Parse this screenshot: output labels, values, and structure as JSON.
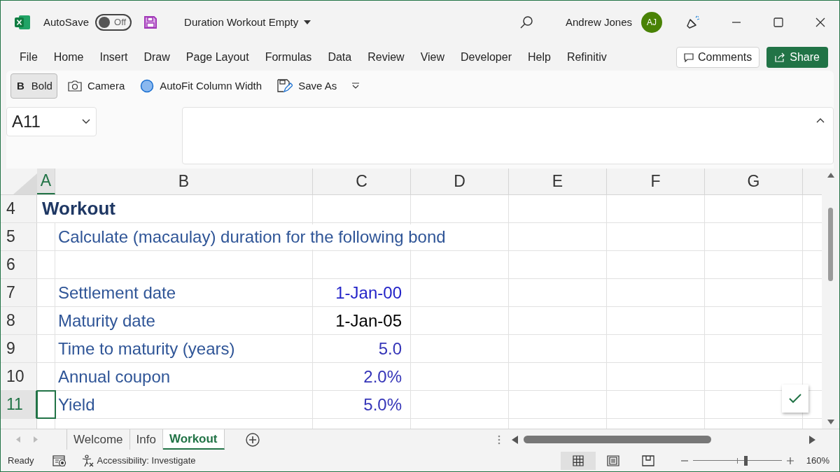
{
  "title_bar": {
    "autosave_label": "AutoSave",
    "autosave": {
      "on": false,
      "label": "Off"
    },
    "document_title": "Duration Workout Empty",
    "user_name": "Andrew Jones",
    "avatar_initials": "AJ"
  },
  "ribbon_tabs": [
    "File",
    "Home",
    "Insert",
    "Draw",
    "Page Layout",
    "Formulas",
    "Data",
    "Review",
    "View",
    "Developer",
    "Help",
    "Refinitiv"
  ],
  "comments_button": "Comments",
  "share_button": "Share",
  "quick_access": [
    {
      "kind": "bold",
      "glyph": "B",
      "label": "Bold",
      "selected": true
    },
    {
      "kind": "camera",
      "label": "Camera",
      "selected": false
    },
    {
      "kind": "autofit",
      "label": "AutoFit Column Width",
      "selected": false
    },
    {
      "kind": "saveas",
      "label": "Save As",
      "selected": false
    }
  ],
  "name_box": "A11",
  "columns": [
    {
      "label": "A",
      "selected": true
    },
    {
      "label": "B",
      "selected": false
    },
    {
      "label": "C",
      "selected": false
    },
    {
      "label": "D",
      "selected": false
    },
    {
      "label": "E",
      "selected": false
    },
    {
      "label": "F",
      "selected": false
    },
    {
      "label": "G",
      "selected": false
    }
  ],
  "rows": [
    {
      "label": "4",
      "selected": false,
      "column_a": "Workout"
    },
    {
      "label": "5",
      "selected": false,
      "column_b": "Calculate (macaulay) duration for the following bond"
    },
    {
      "label": "6",
      "selected": false
    },
    {
      "label": "7",
      "selected": false,
      "column_b": "Settlement date",
      "column_c": {
        "text": "1-Jan-00",
        "color": "#2424c8"
      }
    },
    {
      "label": "8",
      "selected": false,
      "column_b": "Maturity date",
      "column_c": {
        "text": "1-Jan-05",
        "color": "#000000"
      }
    },
    {
      "label": "9",
      "selected": false,
      "column_b": "Time to maturity (years)",
      "column_c": {
        "text": "5.0",
        "color": "#3535b8"
      }
    },
    {
      "label": "10",
      "selected": false,
      "column_b": "Annual coupon",
      "column_c": {
        "text": "2.0%",
        "color": "#3535b8"
      }
    },
    {
      "label": "11",
      "selected": true,
      "column_b": "Yield",
      "column_c": {
        "text": "5.0%",
        "color": "#3535b8"
      }
    }
  ],
  "sheet_tabs": [
    {
      "label": "Welcome",
      "selected": false
    },
    {
      "label": "Info",
      "selected": false
    },
    {
      "label": "Workout",
      "selected": true
    }
  ],
  "status_bar": {
    "status": "Ready",
    "accessibility": "Accessibility: Investigate",
    "views": [
      {
        "kind": "normal",
        "selected": true
      },
      {
        "kind": "page_layout",
        "selected": false
      },
      {
        "kind": "page_break",
        "selected": false
      }
    ],
    "zoom": {
      "level": 0.6,
      "reading": "160%"
    }
  }
}
